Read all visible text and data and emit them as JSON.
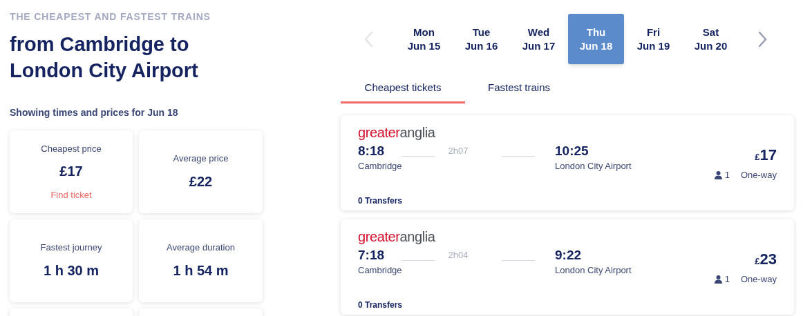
{
  "eyebrow": "THE CHEAPEST AND FASTEST TRAINS",
  "heading": "from Cambridge to London City Airport",
  "subheading": "Showing times and prices for Jun 18",
  "stats": [
    {
      "label": "Cheapest price",
      "value": "£17",
      "link": "Find ticket"
    },
    {
      "label": "Average price",
      "value": "£22"
    },
    {
      "label": "Fastest journey",
      "value": "1 h 30 m"
    },
    {
      "label": "Average duration",
      "value": "1 h 54 m"
    }
  ],
  "date_nav": {
    "prev_disabled": true,
    "next_disabled": false
  },
  "dates": [
    {
      "day": "Mon",
      "date": "Jun 15",
      "selected": false
    },
    {
      "day": "Tue",
      "date": "Jun 16",
      "selected": false
    },
    {
      "day": "Wed",
      "date": "Jun 17",
      "selected": false
    },
    {
      "day": "Thu",
      "date": "Jun 18",
      "selected": true
    },
    {
      "day": "Fri",
      "date": "Jun 19",
      "selected": false
    },
    {
      "day": "Sat",
      "date": "Jun 20",
      "selected": false
    }
  ],
  "tabs": [
    {
      "label": "Cheapest tickets",
      "selected": true
    },
    {
      "label": "Fastest trains",
      "selected": false
    }
  ],
  "journeys": [
    {
      "operator": {
        "first": "greater",
        "second": "anglia"
      },
      "depart_time": "8:18",
      "depart_station": "Cambridge",
      "duration": "2h07",
      "arrive_time": "10:25",
      "arrive_station": "London City Airport",
      "currency": "£",
      "price": "17",
      "passengers": "1",
      "ticket_type": "One-way",
      "transfers": "0 Transfers"
    },
    {
      "operator": {
        "first": "greater",
        "second": "anglia"
      },
      "depart_time": "7:18",
      "depart_station": "Cambridge",
      "duration": "2h04",
      "arrive_time": "9:22",
      "arrive_station": "London City Airport",
      "currency": "£",
      "price": "23",
      "passengers": "1",
      "ticket_type": "One-way",
      "transfers": "0 Transfers"
    }
  ]
}
